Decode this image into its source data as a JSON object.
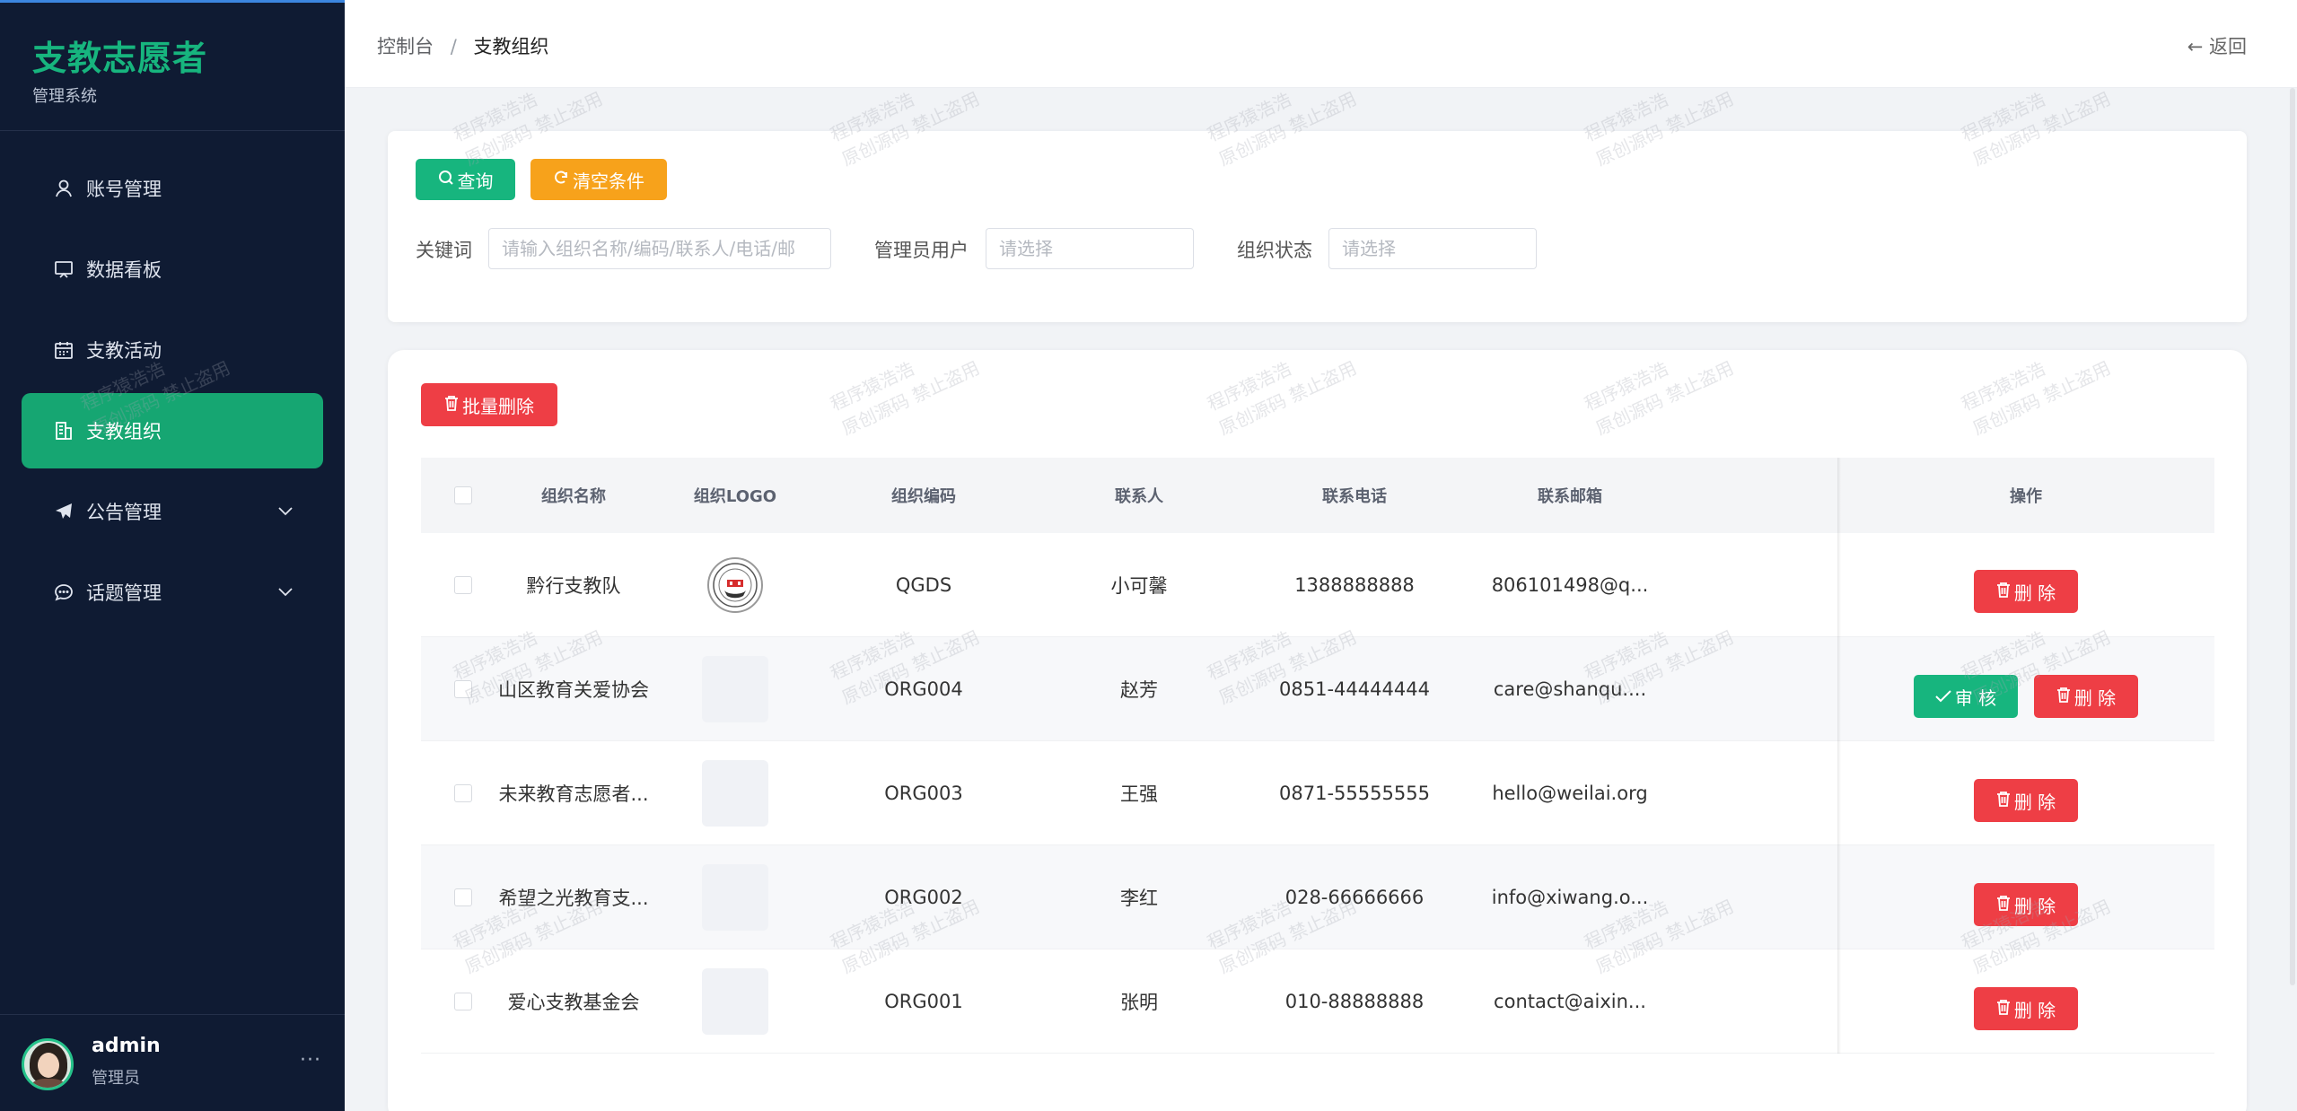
{
  "brand": {
    "title": "支教志愿者",
    "subtitle": "管理系统"
  },
  "menu": [
    {
      "label": "账号管理",
      "icon": "user-icon"
    },
    {
      "label": "数据看板",
      "icon": "dashboard-icon"
    },
    {
      "label": "支教活动",
      "icon": "calendar-icon"
    },
    {
      "label": "支教组织",
      "icon": "building-icon",
      "active": true
    },
    {
      "label": "公告管理",
      "icon": "send-icon",
      "expandable": true
    },
    {
      "label": "话题管理",
      "icon": "chat-icon",
      "expandable": true
    }
  ],
  "user": {
    "name": "admin",
    "role": "管理员",
    "more": "···"
  },
  "header": {
    "breadcrumb_home": "控制台",
    "breadcrumb_sep": "/",
    "breadcrumb_current": "支教组织",
    "back_label": "返回"
  },
  "search": {
    "query_label": "查询",
    "clear_label": "清空条件",
    "keyword_label": "关键词",
    "keyword_placeholder": "请输入组织名称/编码/联系人/电话/邮",
    "admin_label": "管理员用户",
    "admin_placeholder": "请选择",
    "status_label": "组织状态",
    "status_placeholder": "请选择"
  },
  "table": {
    "batch_delete_label": "批量删除",
    "columns": [
      "组织名称",
      "组织LOGO",
      "组织编码",
      "联系人",
      "联系电话",
      "联系邮箱",
      "操作"
    ],
    "rows": [
      {
        "name": "黔行支教队",
        "code": "QGDS",
        "contact": "小可馨",
        "phone": "1388888888",
        "email": "806101498@q...",
        "has_logo": true,
        "actions": [
          "删 除"
        ]
      },
      {
        "name": "山区教育关爱协会",
        "code": "ORG004",
        "contact": "赵芳",
        "phone": "0851-44444444",
        "email": "care@shanqu....",
        "has_logo": false,
        "actions": [
          "审 核",
          "删 除"
        ]
      },
      {
        "name": "未来教育志愿者...",
        "code": "ORG003",
        "contact": "王强",
        "phone": "0871-55555555",
        "email": "hello@weilai.org",
        "has_logo": false,
        "actions": [
          "删 除"
        ]
      },
      {
        "name": "希望之光教育支...",
        "code": "ORG002",
        "contact": "李红",
        "phone": "028-66666666",
        "email": "info@xiwang.o...",
        "has_logo": false,
        "actions": [
          "删 除"
        ]
      },
      {
        "name": "爱心支教基金会",
        "code": "ORG001",
        "contact": "张明",
        "phone": "010-88888888",
        "email": "contact@aixin...",
        "has_logo": false,
        "actions": [
          "删 除"
        ]
      }
    ]
  },
  "watermark": {
    "line1": "程序猿浩浩",
    "line2": "原创源码 禁止盗用"
  },
  "colors": {
    "sidebar_bg": "#0f1b33",
    "accent_green": "#16a672",
    "warning_orange": "#f7a21b",
    "danger_red": "#ee3e45"
  }
}
